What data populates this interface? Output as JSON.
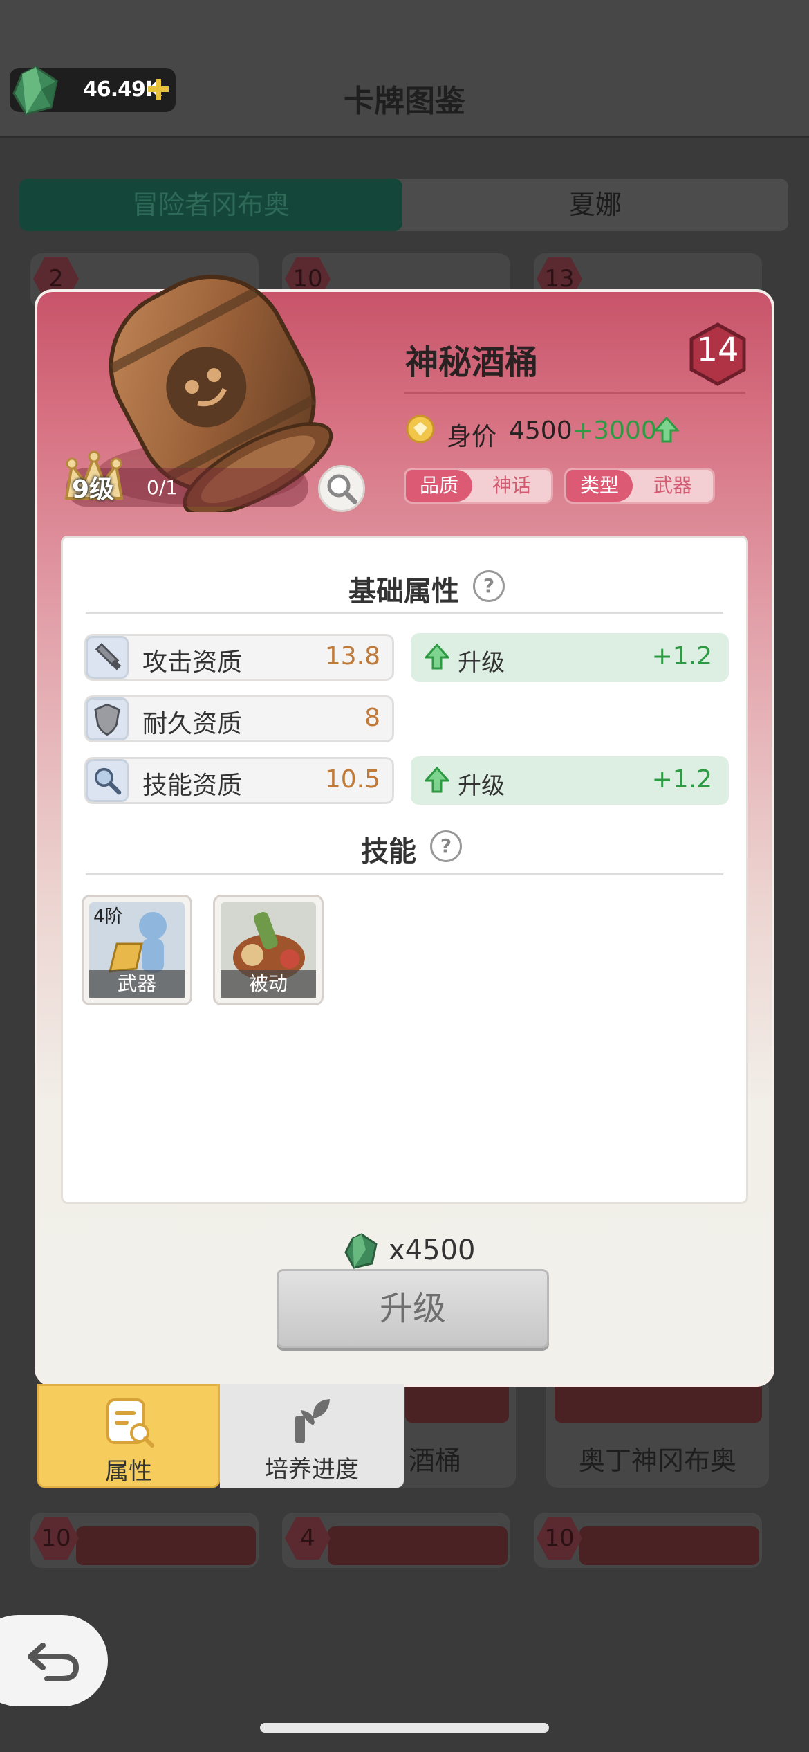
{
  "header": {
    "title": "卡牌图鉴",
    "currency": "46.49K"
  },
  "tabs": [
    "冒险者冈布奥",
    "夏娜"
  ],
  "background_cards": {
    "row1_levels": [
      "2",
      "10",
      "13"
    ],
    "row2_titles": [
      "酒桶",
      "奥丁神冈布奥"
    ],
    "row3_levels": [
      "10",
      "4",
      "10"
    ]
  },
  "card": {
    "name": "神秘酒桶",
    "level": "14",
    "star_level": "9级",
    "progress": "0/1",
    "price_label": "身价",
    "price": "4500",
    "price_increase": "+3000",
    "quality_key": "品质",
    "quality_value": "神话",
    "type_key": "类型",
    "type_value": "武器"
  },
  "basic_attributes": {
    "title": "基础属性",
    "help": "?",
    "stats": [
      {
        "label": "攻击资质",
        "value": "13.8",
        "upgrade_label": "升级",
        "upgrade_value": "+1.2"
      },
      {
        "label": "耐久资质",
        "value": "8"
      },
      {
        "label": "技能资质",
        "value": "10.5",
        "upgrade_label": "升级",
        "upgrade_value": "+1.2"
      }
    ]
  },
  "skills": {
    "title": "技能",
    "help": "?",
    "items": [
      {
        "tier": "4阶",
        "caption": "武器"
      },
      {
        "caption": "被动"
      }
    ]
  },
  "upgrade": {
    "cost": "x4500",
    "button": "升级"
  },
  "bottom_tabs": [
    "属性",
    "培养进度"
  ],
  "colors": {
    "accent_green": "#2e9a44",
    "value_orange": "#c07a3a",
    "tab_active": "#f6cd5c",
    "pill_red": "#dd5a74"
  }
}
